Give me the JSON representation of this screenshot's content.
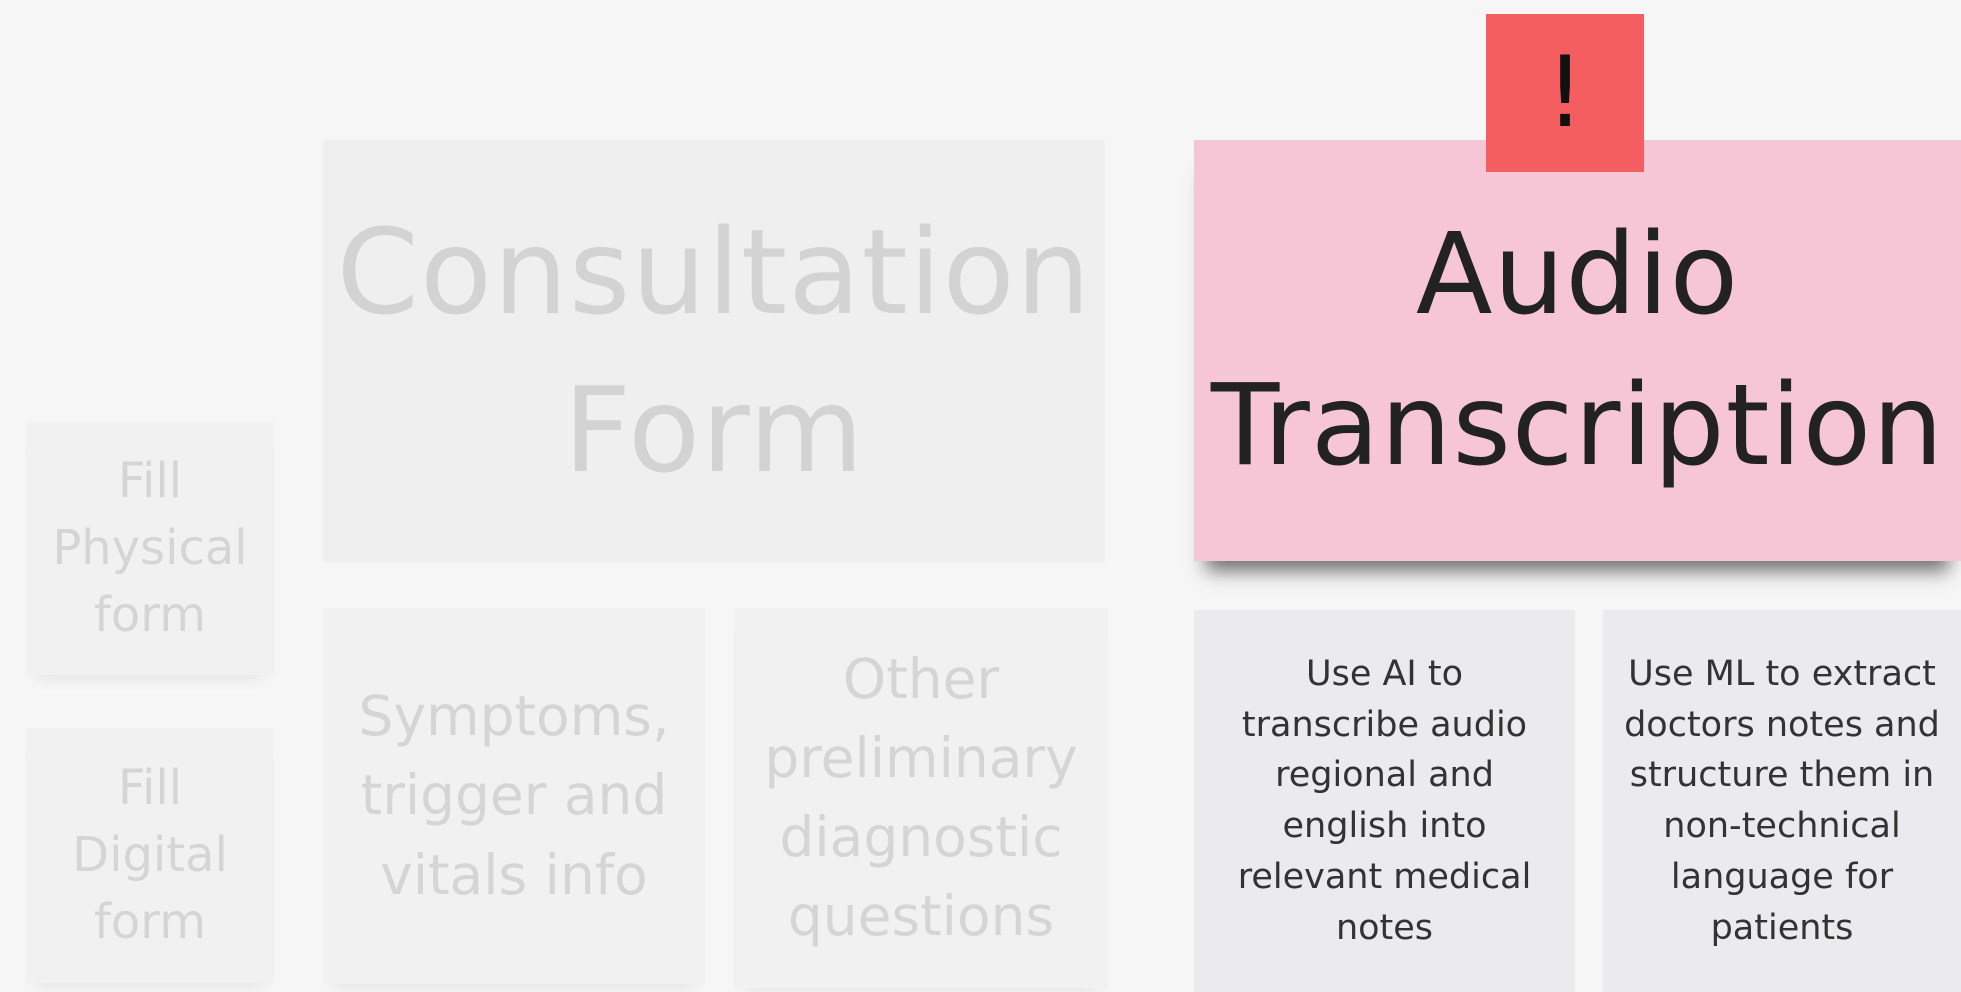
{
  "notes": {
    "fill_physical": [
      "Fill",
      "Physical",
      "form"
    ],
    "fill_digital": [
      "Fill",
      "Digital",
      "form"
    ],
    "consultation_form": [
      "Consultation",
      "Form"
    ],
    "symptoms": [
      "Symptoms,",
      "trigger and",
      "vitals info"
    ],
    "other_questions": [
      "Other",
      "preliminary",
      "diagnostic",
      "questions"
    ],
    "audio_transcription": [
      "Audio",
      "Transcription"
    ],
    "use_ai": [
      "Use AI to",
      "transcribe audio",
      "regional and",
      "english into",
      "relevant medical",
      "notes"
    ],
    "use_ml": [
      "Use ML to extract",
      "doctors notes and",
      "structure them in",
      "non-technical",
      "language for",
      "patients"
    ]
  },
  "alert": {
    "symbol": "!"
  },
  "colors": {
    "background": "#f6f6f6",
    "faded_note": "#f1f1f1",
    "highlight_note": "#f7c6d6",
    "detail_note": "#ebebed",
    "alert_flag": "#f45e60"
  }
}
